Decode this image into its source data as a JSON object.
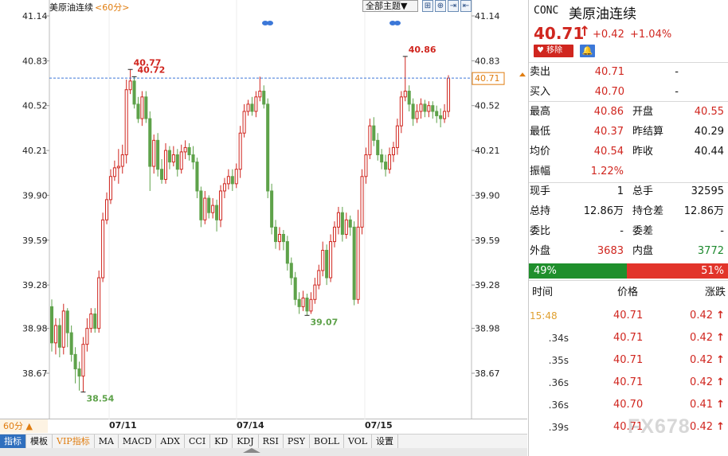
{
  "chart": {
    "instrument": "美原油连续",
    "period_tag": "<60分>",
    "theme_label": "全部主题▼",
    "tool_icons": [
      "grid-icon",
      "zoom-in-icon",
      "enter-icon",
      "exit-icon"
    ],
    "period_button": "60分 ▲",
    "current_price_tag": "40.71",
    "watermark": "FX678"
  },
  "chart_data": {
    "type": "candlestick",
    "y_ticks": [
      41.14,
      40.83,
      40.52,
      40.21,
      39.9,
      39.59,
      39.28,
      38.98,
      38.67
    ],
    "ylim": [
      38.4,
      41.22
    ],
    "x_dates": [
      "07/11",
      "07/14",
      "07/15"
    ],
    "annotations": [
      {
        "label": "40.77",
        "value": 40.77,
        "kind": "high"
      },
      {
        "label": "40.72",
        "value": 40.72,
        "kind": "high"
      },
      {
        "label": "40.86",
        "value": 40.86,
        "kind": "high"
      },
      {
        "label": "38.54",
        "value": 38.54,
        "kind": "low"
      },
      {
        "label": "39.07",
        "value": 39.07,
        "kind": "low"
      }
    ],
    "last_price": 40.71,
    "candles": [
      [
        39.13,
        38.88,
        39.18,
        38.82
      ],
      [
        38.88,
        39.0,
        39.05,
        38.8
      ],
      [
        39.0,
        38.85,
        39.05,
        38.78
      ],
      [
        38.85,
        39.1,
        39.15,
        38.8
      ],
      [
        39.1,
        38.95,
        39.12,
        38.85
      ],
      [
        38.95,
        38.8,
        39.0,
        38.75
      ],
      [
        38.8,
        38.7,
        38.85,
        38.6
      ],
      [
        38.7,
        38.65,
        38.75,
        38.55
      ],
      [
        38.65,
        38.87,
        38.92,
        38.54
      ],
      [
        38.87,
        38.98,
        39.05,
        38.82
      ],
      [
        38.98,
        39.08,
        39.12,
        38.95
      ],
      [
        39.08,
        38.98,
        39.12,
        38.95
      ],
      [
        38.98,
        39.33,
        39.38,
        38.95
      ],
      [
        39.33,
        39.73,
        39.78,
        39.3
      ],
      [
        39.73,
        39.87,
        39.92,
        39.7
      ],
      [
        39.87,
        40.03,
        40.08,
        39.84
      ],
      [
        40.03,
        40.09,
        40.14,
        40.0
      ],
      [
        40.09,
        40.1,
        40.22,
        39.98
      ],
      [
        40.1,
        40.18,
        40.25,
        40.05
      ],
      [
        40.18,
        40.63,
        40.7,
        40.12
      ],
      [
        40.63,
        40.69,
        40.77,
        40.6
      ],
      [
        40.69,
        40.53,
        40.72,
        40.5
      ],
      [
        40.53,
        40.43,
        40.58,
        40.4
      ],
      [
        40.43,
        40.58,
        40.62,
        40.38
      ],
      [
        40.58,
        40.43,
        40.62,
        40.4
      ],
      [
        40.43,
        40.1,
        40.48,
        39.93
      ],
      [
        40.1,
        40.28,
        40.32,
        40.05
      ],
      [
        40.28,
        40.08,
        40.33,
        40.03
      ],
      [
        40.08,
        40.01,
        40.15,
        39.98
      ],
      [
        40.01,
        40.21,
        40.26,
        39.98
      ],
      [
        40.21,
        40.13,
        40.24,
        40.08
      ],
      [
        40.13,
        40.18,
        40.24,
        40.1
      ],
      [
        40.18,
        40.08,
        40.22,
        40.03
      ],
      [
        40.08,
        40.2,
        40.25,
        40.05
      ],
      [
        40.2,
        40.23,
        40.28,
        40.15
      ],
      [
        40.23,
        40.18,
        40.26,
        40.14
      ],
      [
        40.18,
        40.13,
        40.24,
        40.08
      ],
      [
        40.13,
        39.93,
        40.16,
        39.88
      ],
      [
        39.93,
        39.73,
        39.96,
        39.68
      ],
      [
        39.73,
        39.88,
        39.93,
        39.7
      ],
      [
        39.88,
        39.78,
        39.9,
        39.74
      ],
      [
        39.78,
        39.83,
        39.88,
        39.74
      ],
      [
        39.83,
        39.73,
        39.87,
        39.65
      ],
      [
        39.73,
        39.93,
        39.97,
        39.68
      ],
      [
        39.93,
        39.98,
        40.02,
        39.88
      ],
      [
        39.98,
        40.03,
        40.08,
        39.94
      ],
      [
        40.03,
        39.98,
        40.08,
        39.93
      ],
      [
        39.98,
        40.08,
        40.12,
        39.95
      ],
      [
        40.08,
        40.33,
        40.38,
        40.02
      ],
      [
        40.33,
        40.48,
        40.53,
        40.3
      ],
      [
        40.48,
        40.53,
        40.56,
        40.45
      ],
      [
        40.53,
        40.48,
        40.58,
        40.45
      ],
      [
        40.48,
        40.58,
        40.62,
        40.44
      ],
      [
        40.58,
        40.62,
        40.72,
        40.55
      ],
      [
        40.62,
        40.53,
        40.66,
        40.5
      ],
      [
        40.53,
        39.93,
        40.57,
        39.88
      ],
      [
        39.93,
        39.68,
        39.98,
        39.63
      ],
      [
        39.68,
        39.58,
        39.73,
        39.53
      ],
      [
        39.58,
        39.63,
        39.68,
        39.52
      ],
      [
        39.63,
        39.58,
        39.66,
        39.52
      ],
      [
        39.58,
        39.43,
        39.62,
        39.38
      ],
      [
        39.43,
        39.33,
        39.47,
        39.28
      ],
      [
        39.33,
        39.18,
        39.37,
        39.14
      ],
      [
        39.18,
        39.13,
        39.23,
        39.08
      ],
      [
        39.13,
        39.19,
        39.24,
        39.1
      ],
      [
        39.19,
        39.1,
        39.22,
        39.07
      ],
      [
        39.1,
        39.18,
        39.23,
        39.08
      ],
      [
        39.18,
        39.28,
        39.33,
        39.15
      ],
      [
        39.28,
        39.38,
        39.42,
        39.25
      ],
      [
        39.38,
        39.52,
        39.58,
        39.34
      ],
      [
        39.52,
        39.33,
        39.56,
        39.28
      ],
      [
        39.33,
        39.58,
        39.63,
        39.3
      ],
      [
        39.58,
        39.68,
        39.72,
        39.54
      ],
      [
        39.68,
        39.78,
        39.82,
        39.63
      ],
      [
        39.78,
        39.63,
        39.82,
        39.58
      ],
      [
        39.63,
        39.73,
        39.78,
        39.6
      ],
      [
        39.73,
        39.68,
        39.76,
        39.62
      ],
      [
        39.68,
        39.18,
        39.72,
        39.14
      ],
      [
        39.18,
        39.68,
        39.8,
        39.15
      ],
      [
        39.68,
        40.03,
        40.08,
        39.63
      ],
      [
        40.03,
        40.18,
        40.23,
        39.98
      ],
      [
        40.18,
        40.38,
        40.43,
        40.15
      ],
      [
        40.38,
        40.28,
        40.44,
        40.24
      ],
      [
        40.28,
        40.18,
        40.33,
        40.14
      ],
      [
        40.18,
        40.13,
        40.22,
        40.08
      ],
      [
        40.13,
        40.08,
        40.18,
        40.03
      ],
      [
        40.08,
        40.18,
        40.23,
        40.05
      ],
      [
        40.18,
        40.23,
        40.27,
        40.13
      ],
      [
        40.23,
        40.38,
        40.43,
        40.18
      ],
      [
        40.38,
        40.58,
        40.62,
        40.33
      ],
      [
        40.58,
        40.62,
        40.86,
        40.55
      ],
      [
        40.62,
        40.53,
        40.66,
        40.48
      ],
      [
        40.53,
        40.43,
        40.57,
        40.38
      ],
      [
        40.43,
        40.48,
        40.53,
        40.4
      ],
      [
        40.48,
        40.53,
        40.57,
        40.43
      ],
      [
        40.53,
        40.48,
        40.56,
        40.44
      ],
      [
        40.48,
        40.52,
        40.55,
        40.44
      ],
      [
        40.52,
        40.48,
        40.55,
        40.43
      ],
      [
        40.48,
        40.45,
        40.52,
        40.4
      ],
      [
        40.45,
        40.43,
        40.5,
        40.37
      ],
      [
        40.43,
        40.48,
        40.53,
        40.4
      ],
      [
        40.48,
        40.71,
        40.73,
        40.44
      ]
    ]
  },
  "quote": {
    "code": "CONC",
    "name": "美原油连续",
    "price": "40.71",
    "change": "+0.42",
    "change_pct": "+1.04%",
    "remove_label": "移除",
    "sell_label": "卖出",
    "sell_price": "40.71",
    "sell_vol": "-",
    "buy_label": "买入",
    "buy_price": "40.70",
    "buy_vol": "-",
    "rows": [
      {
        "l1": "最高",
        "v1": "40.86",
        "c1": "red",
        "l2": "开盘",
        "v2": "40.55",
        "c2": "red"
      },
      {
        "l1": "最低",
        "v1": "40.37",
        "c1": "red",
        "l2": "昨结算",
        "v2": "40.29",
        "c2": "dark"
      },
      {
        "l1": "均价",
        "v1": "40.54",
        "c1": "red",
        "l2": "昨收",
        "v2": "40.44",
        "c2": "dark"
      },
      {
        "l1": "振幅",
        "v1": "1.22%",
        "c1": "red",
        "l2": "",
        "v2": "",
        "c2": "dark"
      }
    ],
    "rows2": [
      {
        "l1": "现手",
        "v1": "1",
        "c1": "dark",
        "l2": "总手",
        "v2": "32595",
        "c2": "dark"
      },
      {
        "l1": "总持",
        "v1": "12.86万",
        "c1": "dark",
        "l2": "持仓差",
        "v2": "12.86万",
        "c2": "dark"
      },
      {
        "l1": "委比",
        "v1": "-",
        "c1": "dark",
        "l2": "委差",
        "v2": "-",
        "c2": "dark"
      },
      {
        "l1": "外盘",
        "v1": "3683",
        "c1": "red",
        "l2": "内盘",
        "v2": "3772",
        "c2": "green"
      }
    ],
    "buy_ratio": "49%",
    "sell_ratio": "51%",
    "tick_headers": {
      "time": "时间",
      "price": "价格",
      "change": "涨跌"
    },
    "ticks": [
      {
        "time": "15:48",
        "price": "40.71",
        "change": "0.42"
      },
      {
        "time": ".34s",
        "price": "40.71",
        "change": "0.42"
      },
      {
        "time": ".35s",
        "price": "40.71",
        "change": "0.42"
      },
      {
        "time": ".36s",
        "price": "40.71",
        "change": "0.42"
      },
      {
        "time": ".36s",
        "price": "40.70",
        "change": "0.41"
      },
      {
        "time": ".39s",
        "price": "40.71",
        "change": "0.42"
      }
    ]
  },
  "toolbar": {
    "items": [
      "指标",
      "模板",
      "VIP指标",
      "MA",
      "MACD",
      "ADX",
      "CCI",
      "KD",
      "KDJ",
      "RSI",
      "PSY",
      "BOLL",
      "VOL",
      "设置"
    ]
  },
  "colors": {
    "up": "#d0261f",
    "down": "#5ea24a",
    "accent": "#e07d10",
    "grid": "#e3e3e3"
  }
}
